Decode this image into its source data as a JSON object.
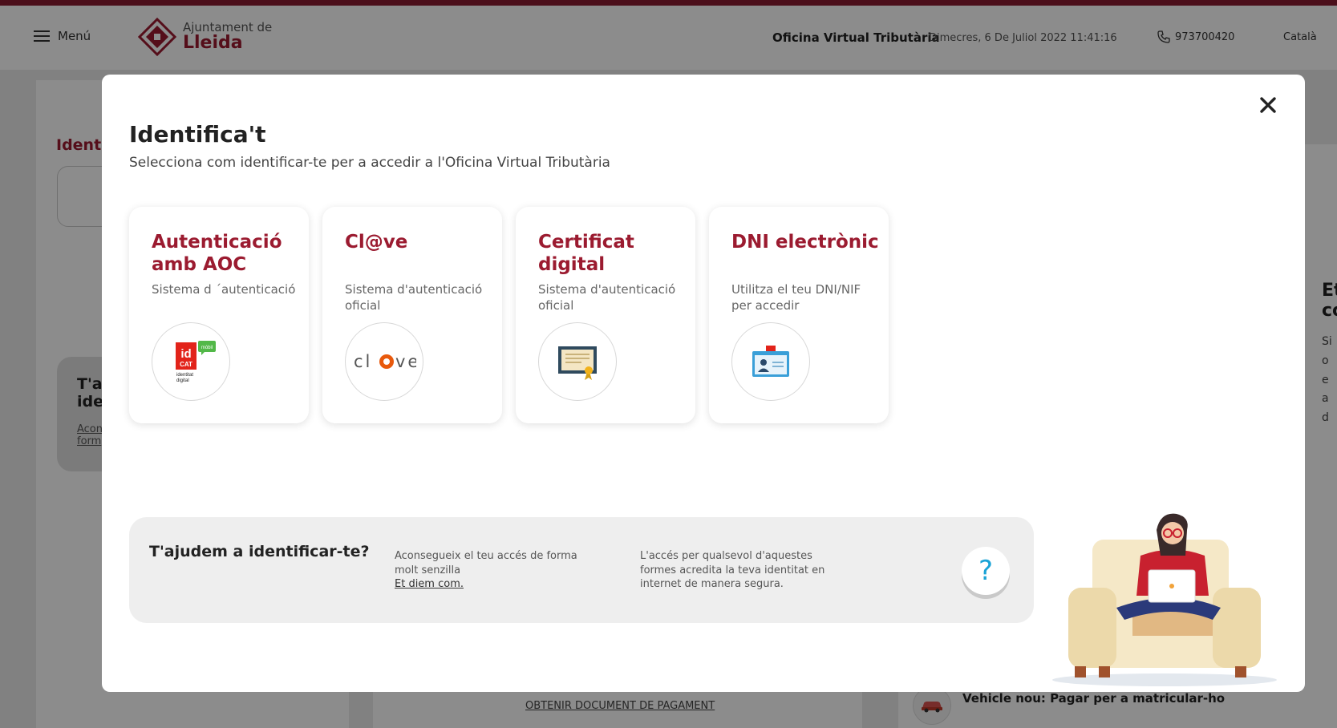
{
  "header": {
    "menu_label": "Menú",
    "logo_top": "Ajuntament de",
    "logo_city": "Lleida",
    "office_title": "Oficina Virtual Tributària",
    "datetime": "Dimecres, 6 De Juliol 2022 11:41:16",
    "phone": "973700420",
    "language": "Català"
  },
  "background": {
    "ident_heading": "Identi",
    "help_title": "T'aj\nide",
    "help_link": "Acon\nform",
    "right_heading": "Et\nco",
    "right_text": "Si\no e\na d",
    "payment_link": "OBTENIR DOCUMENT DE PAGAMENT",
    "vehicle_text": "Vehicle nou: Pagar per a matricular-ho"
  },
  "modal": {
    "title": "Identifica't",
    "subtitle": "Selecciona com identificar-te per a accedir a l'Oficina Virtual Tributària",
    "methods": [
      {
        "title": "Autenticació amb AOC",
        "description": "Sistema d ´autenticació",
        "icon": "idcat-mobil-logo"
      },
      {
        "title": "Cl@ve",
        "description": "Sistema d'autenticació oficial",
        "icon": "clave-logo"
      },
      {
        "title": "Certificat digital",
        "description": "Sistema d'autenticació oficial",
        "icon": "digital-certificate-icon"
      },
      {
        "title": "DNI electrònic",
        "description": "Utilitza el teu DNI/NIF per accedir",
        "icon": "id-card-icon"
      }
    ],
    "idcat_logo": {
      "id": "id",
      "cat": "CAT",
      "mobil": "mòbil",
      "caption1": "identitat",
      "caption2": "digital"
    },
    "clave_logo": {
      "left": "cl",
      "right": "ve"
    },
    "help": {
      "title": "T'ajudem a identificar-te?",
      "text1": "Aconsegueix el teu accés de forma molt senzilla",
      "link": "Et diem com.",
      "text2": "L'accés per qualsevol d'aquestes formes acredita la teva identitat en internet de manera segura.",
      "question_mark": "?"
    }
  },
  "colors": {
    "brand": "#9b1b30",
    "accent_orange": "#e8590c",
    "help_blue": "#1aa3d6"
  }
}
